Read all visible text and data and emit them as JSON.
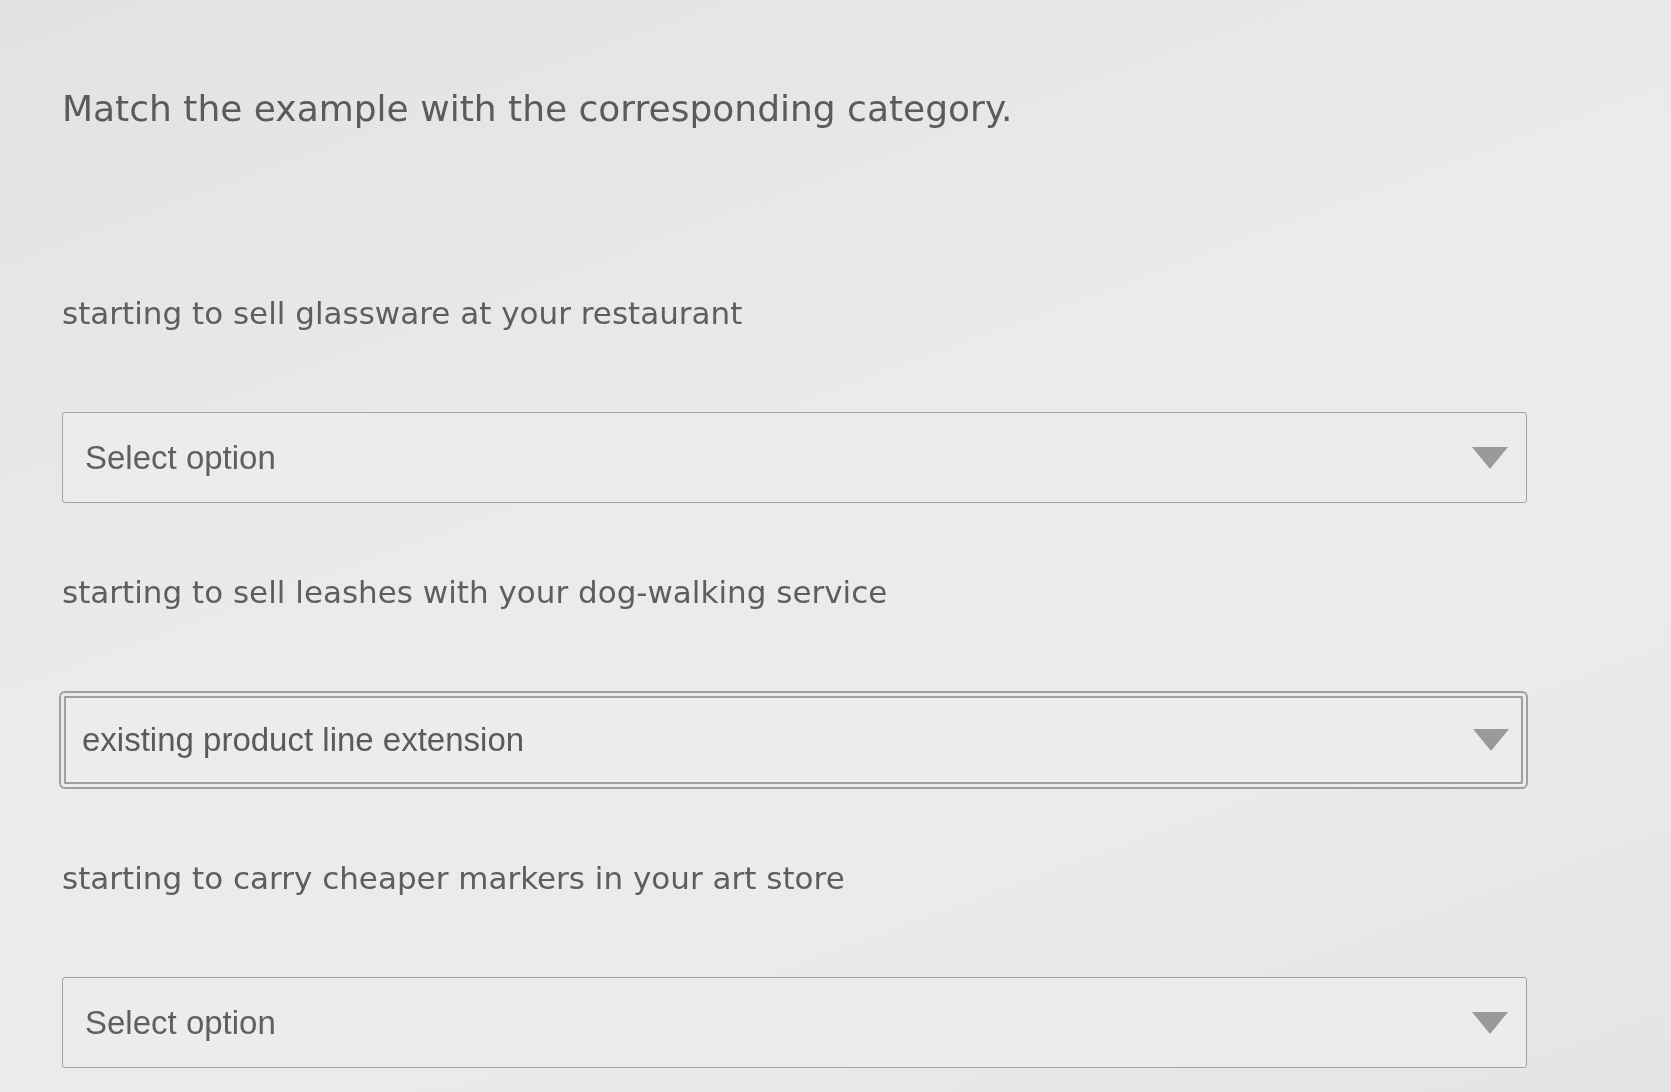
{
  "prompt": "Match the example with the corresponding category.",
  "items": [
    {
      "example": "starting to sell glassware at your restaurant",
      "dropdown": {
        "placeholder": "Select option",
        "focused": false
      }
    },
    {
      "example": "starting to sell leashes with your dog-walking service",
      "dropdown": {
        "value": "existing product line extension",
        "focused": true
      }
    },
    {
      "example": "starting to carry cheaper markers in your art store",
      "dropdown": {
        "placeholder": "Select option",
        "focused": false
      }
    }
  ]
}
